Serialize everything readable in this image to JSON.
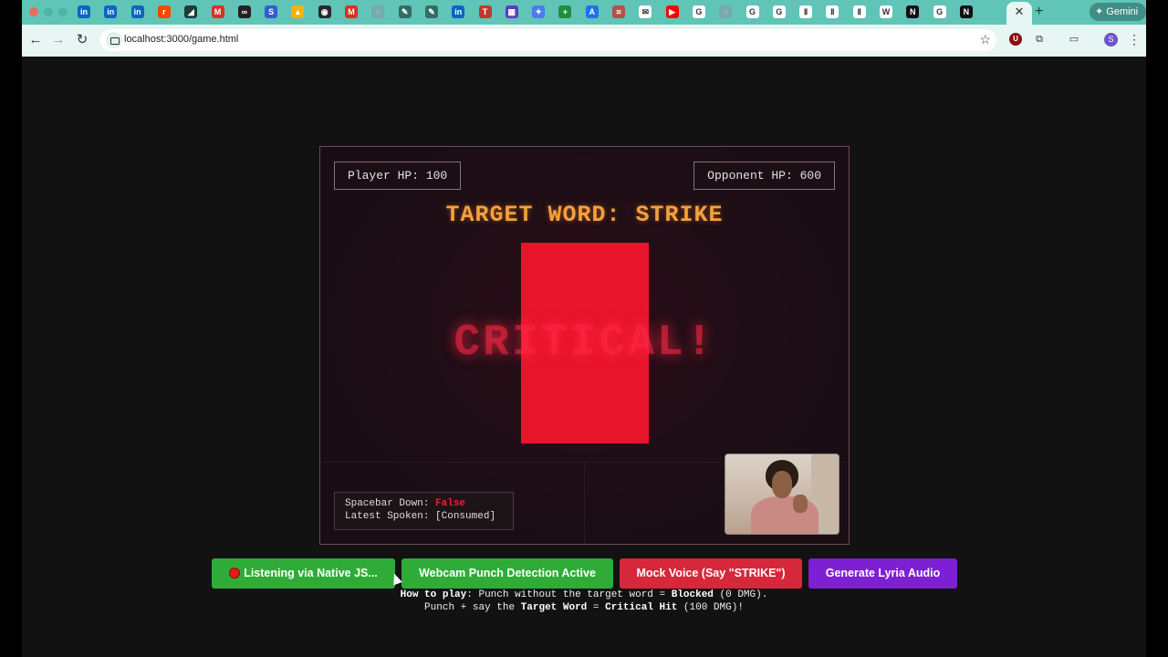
{
  "browser": {
    "url": "localhost:3000/game.html",
    "gemini_label": "Gemini",
    "profile_initial": "S",
    "tab_icons": [
      "linkedin-icon",
      "linkedin-icon",
      "linkedin-icon",
      "reddit-icon",
      "nvidia-icon",
      "gmail-icon",
      "loop-icon",
      "s-icon",
      "drive-icon",
      "github-icon",
      "gmail-icon",
      "globe-icon",
      "pen-icon",
      "pen-icon",
      "linkedin-icon",
      "t-icon",
      "calendar-icon",
      "spark-icon",
      "plus-green-icon",
      "arc-icon",
      "grid-icon",
      "mail-icon",
      "youtube-icon",
      "google-icon",
      "globe-icon",
      "google-icon",
      "google-icon",
      "pause-icon",
      "pause-icon",
      "pause-icon",
      "wiki-icon",
      "notion-icon",
      "google-icon",
      "notion-icon"
    ]
  },
  "game": {
    "player_hp": "Player HP: 100",
    "opponent_hp": "Opponent HP: 600",
    "target_word": "TARGET WORD: STRIKE",
    "hit_text": "CRITICAL!",
    "spacebar_label": "Spacebar Down:",
    "spacebar_value": "False",
    "latest_spoken_label": "Latest Spoken:",
    "latest_spoken_value": "[Consumed]"
  },
  "controls": {
    "listen_label": "Listening via Native JS...",
    "webcam_label": "Webcam Punch Detection Active",
    "mock_label": "Mock Voice (Say \"STRIKE\")",
    "lyria_label": "Generate Lyria Audio"
  },
  "howto": {
    "line1_bold": "How to play",
    "line1_a": ": Punch without the target word = ",
    "line1_bold2": "Blocked",
    "line1_b": " (0 DMG).",
    "line2_a": "Punch + say the ",
    "line2_bold": "Target Word",
    "line2_b": " = ",
    "line2_bold2": "Critical Hit",
    "line2_c": " (100 DMG)!"
  },
  "colors": {
    "accent_orange": "#f5a03b",
    "hit_red": "#e8142c",
    "green": "#2eac37",
    "purple": "#7d1fd3"
  }
}
